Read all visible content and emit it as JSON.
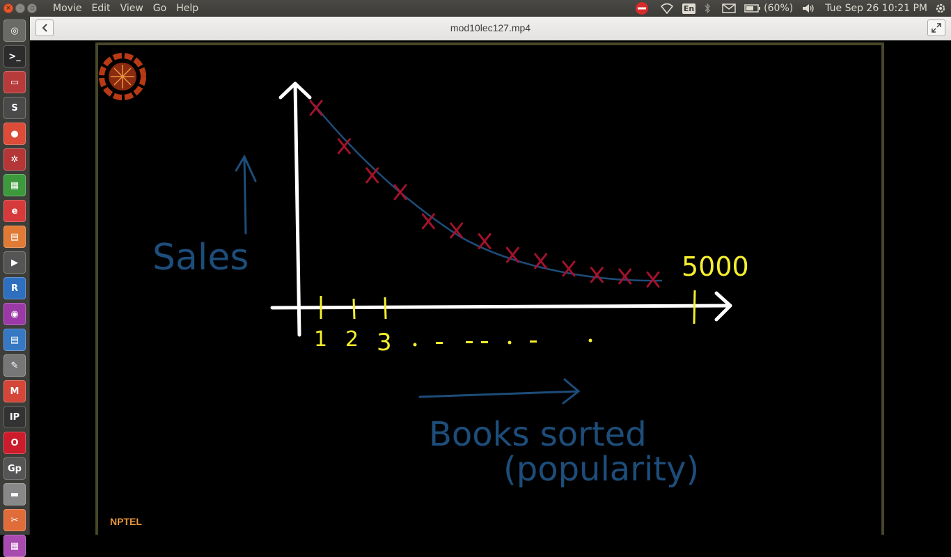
{
  "menu": {
    "items": [
      "Movie",
      "Edit",
      "View",
      "Go",
      "Help"
    ]
  },
  "indicators": {
    "keyboard": "En",
    "battery": "(60%)",
    "datetime": "Tue Sep 26 10:21 PM"
  },
  "window": {
    "title": "mod10lec127.mp4"
  },
  "launcher": {
    "items": [
      {
        "name": "dash-icon",
        "glyph": "◎",
        "color": "#6a6a66"
      },
      {
        "name": "terminal-icon",
        "glyph": ">_",
        "color": "#2c2c2c"
      },
      {
        "name": "files-icon",
        "glyph": "▭",
        "color": "#b83b3b"
      },
      {
        "name": "sublime-icon",
        "glyph": "S",
        "color": "#4a4a4a"
      },
      {
        "name": "chrome-icon",
        "glyph": "●",
        "color": "#dd4b39"
      },
      {
        "name": "settings-icon",
        "glyph": "✲",
        "color": "#b53636"
      },
      {
        "name": "spreadsheet-icon",
        "glyph": "▦",
        "color": "#3c9a3c"
      },
      {
        "name": "document-viewer-icon",
        "glyph": "e",
        "color": "#d63a3a"
      },
      {
        "name": "presentation-icon",
        "glyph": "▤",
        "color": "#e07a35"
      },
      {
        "name": "video-player-icon",
        "glyph": "▶",
        "color": "#555"
      },
      {
        "name": "r-icon",
        "glyph": "R",
        "color": "#2e6fbf"
      },
      {
        "name": "media-icon",
        "glyph": "◉",
        "color": "#9b3aa6"
      },
      {
        "name": "writer-icon",
        "glyph": "▤",
        "color": "#3778c2"
      },
      {
        "name": "text-editor-icon",
        "glyph": "✎",
        "color": "#777"
      },
      {
        "name": "gmail-icon",
        "glyph": "M",
        "color": "#d44638"
      },
      {
        "name": "ipython-icon",
        "glyph": "IP",
        "color": "#333"
      },
      {
        "name": "opera-icon",
        "glyph": "O",
        "color": "#cc1b2b"
      },
      {
        "name": "gp-icon",
        "glyph": "Gp",
        "color": "#555"
      },
      {
        "name": "disk-icon",
        "glyph": "▬",
        "color": "#888"
      },
      {
        "name": "tools-icon",
        "glyph": "✂",
        "color": "#e06c3a"
      },
      {
        "name": "app-icon",
        "glyph": "▦",
        "color": "#a84ab0"
      }
    ]
  },
  "board": {
    "y_label": "Sales",
    "x_label_line1": "Books sorted",
    "x_label_line2": "(popularity)",
    "ticks": [
      "1",
      "2",
      "3"
    ],
    "end_label": "5000",
    "watermark": "NPTEL"
  },
  "chart_data": {
    "type": "scatter",
    "title": "",
    "xlabel": "Books sorted (popularity)",
    "ylabel": "Sales",
    "x_tick_labels": [
      "1",
      "2",
      "3",
      "5000"
    ],
    "series": [
      {
        "values": [
          13,
          10.5,
          8.6,
          7.5,
          5.6,
          5.0,
          4.3,
          3.4,
          3.0,
          2.5,
          2.1,
          2.0,
          1.8
        ]
      }
    ],
    "colors": {
      "points": "#a3122b",
      "curve": "#1d4d7a",
      "axes": "#ffffff",
      "ticks": "#f6ef2e"
    }
  }
}
